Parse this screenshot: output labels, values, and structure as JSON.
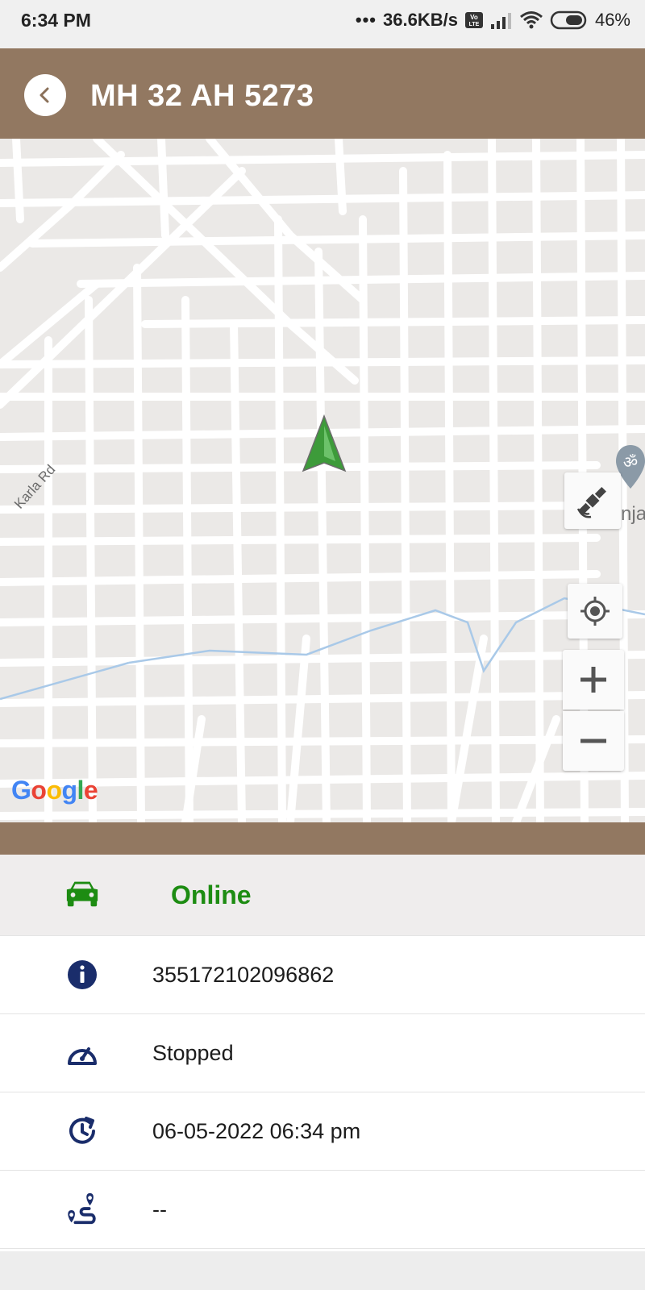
{
  "status_bar": {
    "time": "6:34 PM",
    "network_speed": "36.6KB/s",
    "battery": "46%",
    "icons": [
      "volte-icon",
      "signal-icon",
      "wifi-icon",
      "battery-icon"
    ]
  },
  "header": {
    "title": "MH 32 AH 5273",
    "back_icon": "back-icon",
    "background": "#927861"
  },
  "map": {
    "road_label": "Karla Rd",
    "poi_label": "Anja",
    "attribution": "Google",
    "controls": [
      "satellite-icon",
      "my-location-icon",
      "zoom-in-icon",
      "zoom-out-icon"
    ],
    "marker_color": "#3d9b3a"
  },
  "details": {
    "status": "Online",
    "status_color": "#1d8c12",
    "imei": "355172102096862",
    "motion": "Stopped",
    "last_update": "06-05-2022 06:34 pm",
    "distance": "--",
    "icon_color": "#1a2d6b"
  }
}
